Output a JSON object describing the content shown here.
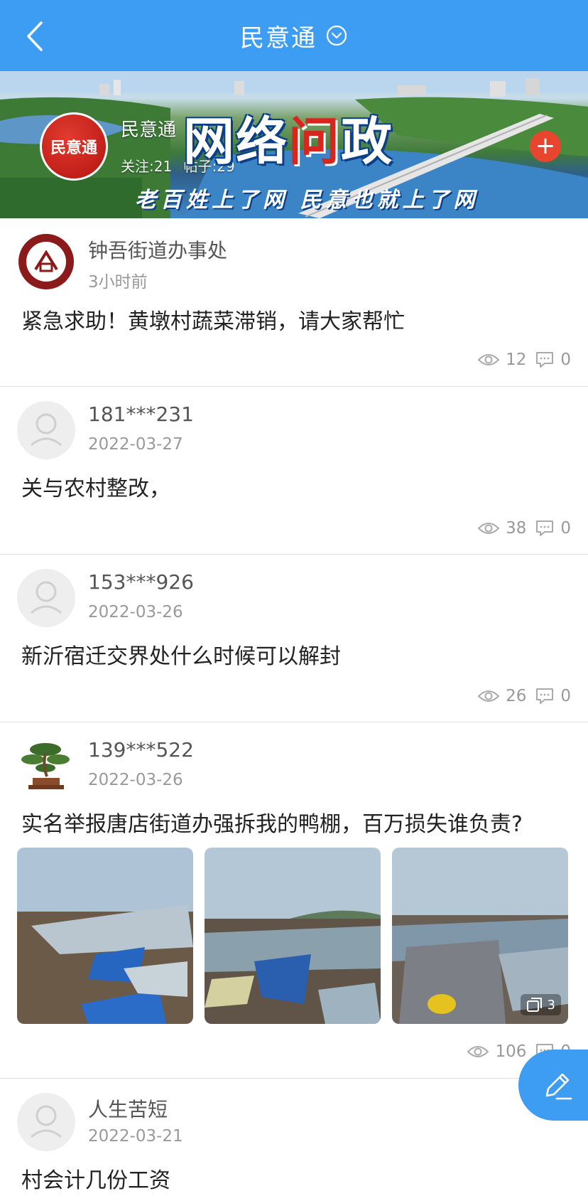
{
  "header": {
    "title": "民意通"
  },
  "banner": {
    "logo_text": "民意通",
    "name": "民意通",
    "follow_label": "关注:21",
    "posts_label": "帖子:29",
    "headline_part1": "网络",
    "headline_red": "问",
    "headline_part2": "政",
    "slogan": "老百姓上了网 民意也就上了网"
  },
  "posts": [
    {
      "author": "钟吾街道办事处",
      "time": "3小时前",
      "content": "紧急求助！黄墩村蔬菜滞销，请大家帮忙",
      "views": "12",
      "comments": "0"
    },
    {
      "author": "181***231",
      "time": "2022-03-27",
      "content": "关与农村整改，",
      "views": "38",
      "comments": "0"
    },
    {
      "author": "153***926",
      "time": "2022-03-26",
      "content": "新沂宿迁交界处什么时候可以解封",
      "views": "26",
      "comments": "0"
    },
    {
      "author": "139***522",
      "time": "2022-03-26",
      "content": "实名举报唐店街道办强拆我的鸭棚，百万损失谁负责?",
      "views": "106",
      "comments": "0",
      "image_count": "3"
    },
    {
      "author": "人生苦短",
      "time": "2022-03-21",
      "content": "村会计几份工资"
    }
  ]
}
